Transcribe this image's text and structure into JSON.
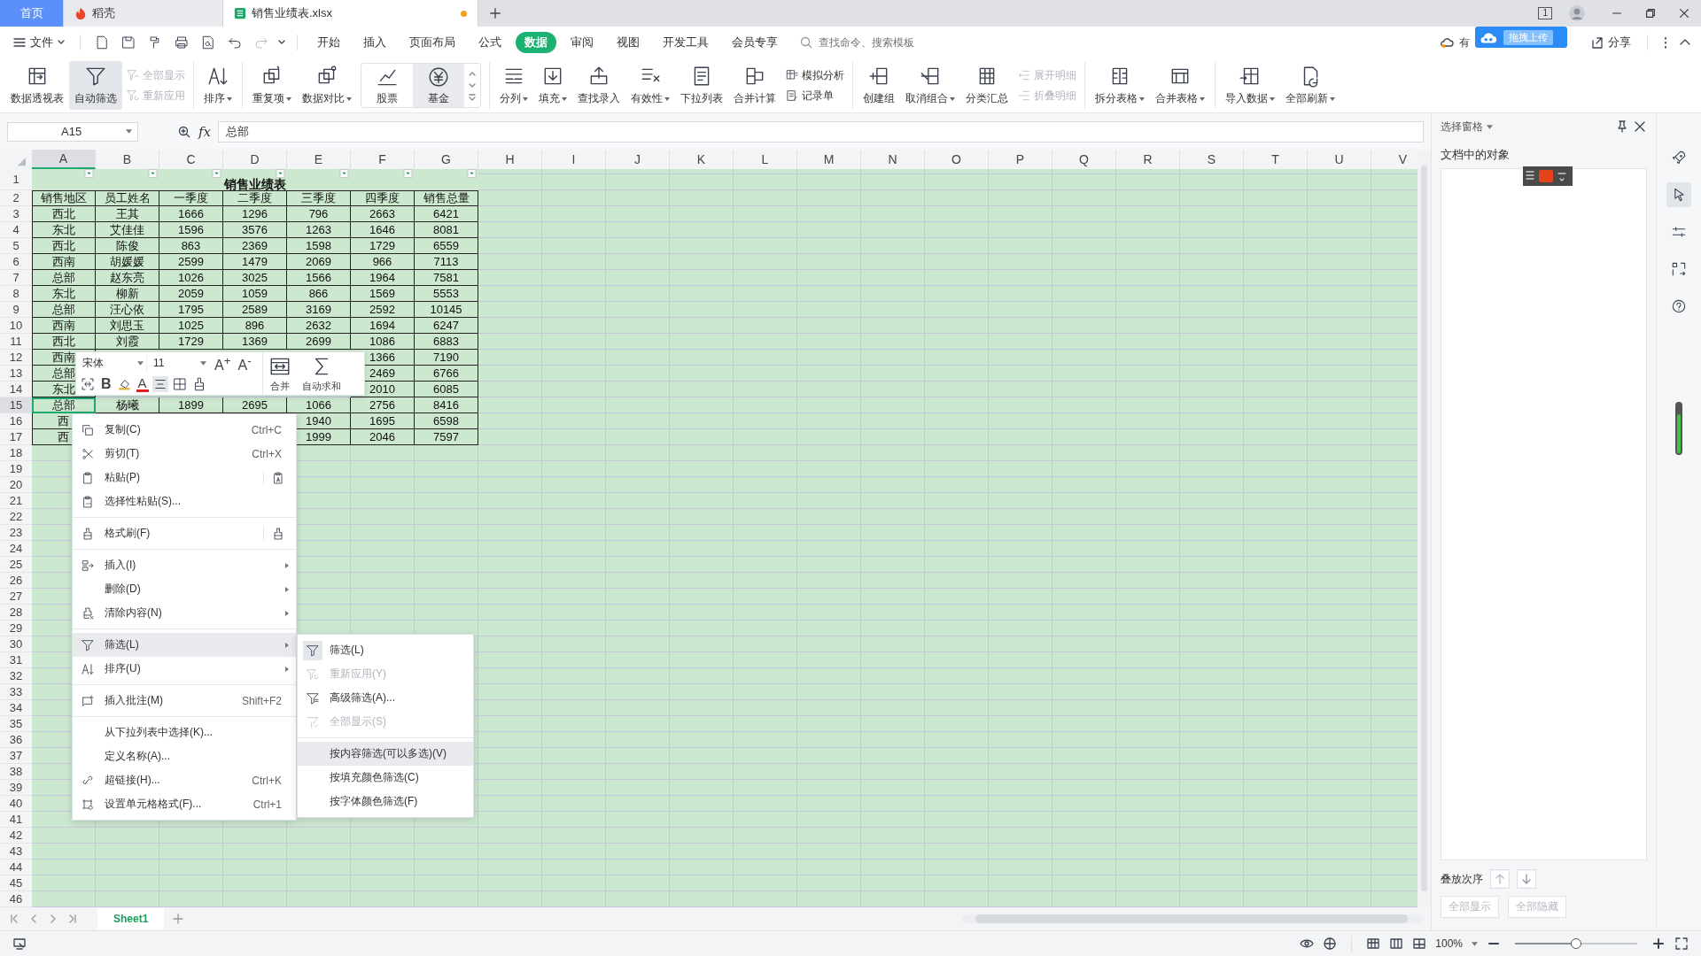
{
  "tabs": [
    {
      "label": "首页",
      "kind": "home",
      "selected": false
    },
    {
      "label": "稻壳",
      "kind": "docer",
      "selected": false
    },
    {
      "label": "销售业绩表.xlsx",
      "kind": "sheet",
      "selected": true,
      "unsaved": true
    }
  ],
  "title_bar": {
    "window_count": "1",
    "upload_badge": "拖拽上传"
  },
  "menu_bar": {
    "file": "文件",
    "tabs": [
      {
        "label": "开始",
        "selected": false
      },
      {
        "label": "插入",
        "selected": false
      },
      {
        "label": "页面布局",
        "selected": false
      },
      {
        "label": "公式",
        "selected": false
      },
      {
        "label": "数据",
        "selected": true
      },
      {
        "label": "审阅",
        "selected": false
      },
      {
        "label": "视图",
        "selected": false
      },
      {
        "label": "开发工具",
        "selected": false
      },
      {
        "label": "会员专享",
        "selected": false
      }
    ],
    "search": {
      "placeholder": "查找命令、搜索模板"
    },
    "cloud_text": "有",
    "share": "分享"
  },
  "ribbon": [
    {
      "kind": "large",
      "label": "数据透视表",
      "dropdown": false,
      "selected": false
    },
    {
      "kind": "large",
      "label": "自动筛选",
      "dropdown": false,
      "selected": true
    },
    {
      "kind": "stack",
      "items": [
        {
          "label": "全部显示",
          "disabled": true
        },
        {
          "label": "重新应用",
          "disabled": true
        }
      ]
    },
    {
      "kind": "divider"
    },
    {
      "kind": "large",
      "label": "排序",
      "dropdown": true,
      "selected": false
    },
    {
      "kind": "divider"
    },
    {
      "kind": "large",
      "label": "重复项",
      "dropdown": true,
      "selected": false
    },
    {
      "kind": "large",
      "label": "数据对比",
      "dropdown": true,
      "selected": false
    },
    {
      "kind": "gallery",
      "items": [
        {
          "label": "股票",
          "selected": false
        },
        {
          "label": "基金",
          "selected": true
        }
      ]
    },
    {
      "kind": "divider"
    },
    {
      "kind": "large",
      "label": "分列",
      "dropdown": true,
      "selected": false
    },
    {
      "kind": "large",
      "label": "填充",
      "dropdown": true,
      "selected": false
    },
    {
      "kind": "large",
      "label": "查找录入",
      "dropdown": false,
      "selected": false
    },
    {
      "kind": "large",
      "label": "有效性",
      "dropdown": true,
      "selected": false
    },
    {
      "kind": "large",
      "label": "下拉列表",
      "dropdown": false,
      "selected": false
    },
    {
      "kind": "large",
      "label": "合并计算",
      "dropdown": false,
      "selected": false
    },
    {
      "kind": "stack",
      "items": [
        {
          "label": "模拟分析",
          "disabled": false
        },
        {
          "label": "记录单",
          "disabled": false
        }
      ]
    },
    {
      "kind": "divider"
    },
    {
      "kind": "large",
      "label": "创建组",
      "dropdown": false,
      "selected": false
    },
    {
      "kind": "large",
      "label": "取消组合",
      "dropdown": true,
      "selected": false
    },
    {
      "kind": "large",
      "label": "分类汇总",
      "dropdown": false,
      "selected": false
    },
    {
      "kind": "stack",
      "items": [
        {
          "label": "展开明细",
          "disabled": true
        },
        {
          "label": "折叠明细",
          "disabled": true
        }
      ]
    },
    {
      "kind": "divider"
    },
    {
      "kind": "large",
      "label": "拆分表格",
      "dropdown": true,
      "selected": false
    },
    {
      "kind": "large",
      "label": "合并表格",
      "dropdown": true,
      "selected": false
    },
    {
      "kind": "divider"
    },
    {
      "kind": "large",
      "label": "导入数据",
      "dropdown": true,
      "selected": false
    },
    {
      "kind": "large",
      "label": "全部刷新",
      "dropdown": true,
      "selected": false
    }
  ],
  "formula_bar": {
    "cell_ref": "A15",
    "fx": "fx",
    "value": "总部"
  },
  "sheet": {
    "columns": [
      {
        "label": "A",
        "selected": true
      },
      {
        "label": "B",
        "selected": false
      },
      {
        "label": "C",
        "selected": false
      },
      {
        "label": "D",
        "selected": false
      },
      {
        "label": "E",
        "selected": false
      },
      {
        "label": "F",
        "selected": false
      },
      {
        "label": "G",
        "selected": false
      },
      {
        "label": "H",
        "selected": false
      },
      {
        "label": "I",
        "selected": false
      },
      {
        "label": "J",
        "selected": false
      },
      {
        "label": "K",
        "selected": false
      },
      {
        "label": "L",
        "selected": false
      },
      {
        "label": "M",
        "selected": false
      },
      {
        "label": "N",
        "selected": false
      },
      {
        "label": "O",
        "selected": false
      },
      {
        "label": "P",
        "selected": false
      },
      {
        "label": "Q",
        "selected": false
      },
      {
        "label": "R",
        "selected": false
      },
      {
        "label": "S",
        "selected": false
      },
      {
        "label": "T",
        "selected": false
      },
      {
        "label": "U",
        "selected": false
      },
      {
        "label": "V",
        "selected": false
      }
    ],
    "row_labels": [
      "1",
      "2",
      "3",
      "4",
      "5",
      "6",
      "7",
      "8",
      "9",
      "10",
      "11",
      "12",
      "13",
      "14",
      "15",
      "16",
      "17",
      "18",
      "19",
      "20",
      "21",
      "22",
      "23",
      "24",
      "25",
      "26",
      "27",
      "28",
      "29",
      "30",
      "31",
      "32",
      "33",
      "34",
      "35",
      "36",
      "37",
      "38",
      "39",
      "40",
      "41",
      "42",
      "43",
      "44",
      "45",
      "46"
    ],
    "title": "销售业绩表",
    "headers": [
      "销售地区",
      "员工姓名",
      "一季度",
      "二季度",
      "三季度",
      "四季度",
      "销售总量"
    ],
    "rows": [
      {
        "selected": false,
        "cells": [
          "西北",
          "王其",
          "1666",
          "1296",
          "796",
          "2663",
          "6421"
        ]
      },
      {
        "selected": false,
        "cells": [
          "东北",
          "艾佳佳",
          "1596",
          "3576",
          "1263",
          "1646",
          "8081"
        ]
      },
      {
        "selected": false,
        "cells": [
          "西北",
          "陈俊",
          "863",
          "2369",
          "1598",
          "1729",
          "6559"
        ]
      },
      {
        "selected": false,
        "cells": [
          "西南",
          "胡媛媛",
          "2599",
          "1479",
          "2069",
          "966",
          "7113"
        ]
      },
      {
        "selected": false,
        "cells": [
          "总部",
          "赵东亮",
          "1026",
          "3025",
          "1566",
          "1964",
          "7581"
        ]
      },
      {
        "selected": false,
        "cells": [
          "东北",
          "柳新",
          "2059",
          "1059",
          "866",
          "1569",
          "5553"
        ]
      },
      {
        "selected": false,
        "cells": [
          "总部",
          "汪心依",
          "1795",
          "2589",
          "3169",
          "2592",
          "10145"
        ]
      },
      {
        "selected": false,
        "cells": [
          "西南",
          "刘思玉",
          "1025",
          "896",
          "2632",
          "1694",
          "6247"
        ]
      },
      {
        "selected": false,
        "cells": [
          "西北",
          "刘霞",
          "1729",
          "1369",
          "2699",
          "1086",
          "6883"
        ]
      },
      {
        "selected": false,
        "cells": [
          "西南",
          null,
          null,
          null,
          null,
          "1366",
          "7190"
        ]
      },
      {
        "selected": false,
        "cells": [
          "总部",
          null,
          null,
          null,
          null,
          "2469",
          "6766"
        ]
      },
      {
        "selected": false,
        "cells": [
          "东北",
          null,
          null,
          null,
          null,
          "2010",
          "6085"
        ]
      },
      {
        "selected": true,
        "cells": [
          "总部",
          "杨曦",
          "1899",
          "2695",
          "1066",
          "2756",
          "8416"
        ]
      },
      {
        "selected": false,
        "cells": [
          "西",
          null,
          null,
          null,
          "1940",
          "1695",
          "6598"
        ]
      },
      {
        "selected": false,
        "cells": [
          "西",
          null,
          null,
          null,
          "1999",
          "2046",
          "7597"
        ]
      }
    ]
  },
  "mini_toolbar": {
    "font": "宋体",
    "size": "11",
    "grow": "A$^{+}$",
    "shrink": "A$^{-}$",
    "bold": "B",
    "font_color": "A",
    "merge": "合并",
    "autosum": "自动求和"
  },
  "context_menu": {
    "groups": [
      {
        "items": [
          {
            "label": "复制(C)",
            "shortcut": "Ctrl+C",
            "submenu": false,
            "selected": false
          },
          {
            "label": "剪切(T)",
            "shortcut": "Ctrl+X",
            "submenu": false,
            "selected": false
          },
          {
            "label": "粘贴(P)",
            "submenu": false,
            "selected": false
          },
          {
            "label": "选择性粘贴(S)...",
            "submenu": false,
            "selected": false
          }
        ]
      },
      {
        "items": [
          {
            "label": "格式刷(F)",
            "submenu": false,
            "selected": false
          }
        ]
      },
      {
        "items": [
          {
            "label": "插入(I)",
            "submenu": true,
            "selected": false
          },
          {
            "label": "删除(D)",
            "submenu": true,
            "selected": false
          },
          {
            "label": "清除内容(N)",
            "submenu": true,
            "selected": false
          }
        ]
      },
      {
        "items": [
          {
            "label": "筛选(L)",
            "submenu": true,
            "selected": true
          },
          {
            "label": "排序(U)",
            "submenu": true,
            "selected": false
          }
        ]
      },
      {
        "items": [
          {
            "label": "插入批注(M)",
            "shortcut": "Shift+F2",
            "submenu": false,
            "selected": false
          }
        ]
      },
      {
        "items": [
          {
            "label": "从下拉列表中选择(K)...",
            "submenu": false,
            "selected": false
          },
          {
            "label": "定义名称(A)...",
            "submenu": false,
            "selected": false
          },
          {
            "label": "超链接(H)...",
            "shortcut": "Ctrl+K",
            "submenu": false,
            "selected": false
          },
          {
            "label": "设置单元格格式(F)...",
            "shortcut": "Ctrl+1",
            "submenu": false,
            "selected": false
          }
        ]
      }
    ]
  },
  "filter_submenu": {
    "groups": [
      {
        "items": [
          {
            "label": "筛选(L)",
            "disabled": false,
            "selected": false
          },
          {
            "label": "重新应用(Y)",
            "disabled": true,
            "selected": false
          },
          {
            "label": "高级筛选(A)...",
            "disabled": false,
            "selected": false
          },
          {
            "label": "全部显示(S)",
            "disabled": true,
            "selected": false
          }
        ]
      },
      {
        "items": [
          {
            "label": "按内容筛选(可以多选)(V)",
            "disabled": false,
            "selected": true
          },
          {
            "label": "按填充颜色筛选(C)",
            "disabled": false,
            "selected": false
          },
          {
            "label": "按字体颜色筛选(F)",
            "disabled": false,
            "selected": false
          }
        ]
      }
    ]
  },
  "selection_pane": {
    "title": "选择窗格",
    "heading": "文档中的对象",
    "order_label": "叠放次序",
    "show_all": "全部显示",
    "hide_all": "全部隐藏"
  },
  "sheet_tabs": [
    {
      "label": "Sheet1",
      "selected": true
    }
  ],
  "status_bar": {
    "zoom": "100%",
    "zoom_slider": {
      "level": 0.5
    }
  }
}
